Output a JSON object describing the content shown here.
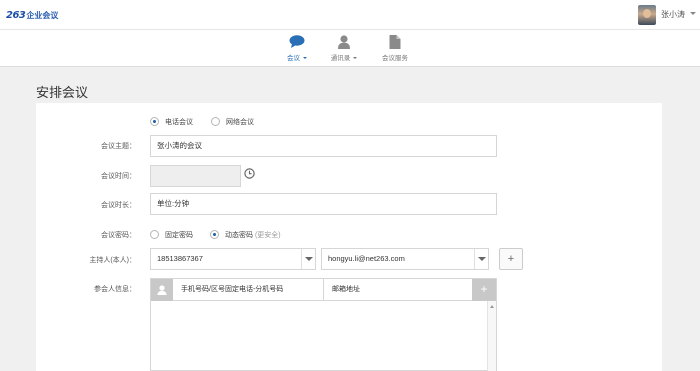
{
  "header": {
    "logo_number": "263",
    "logo_text": "企业会议",
    "username": "张小涛"
  },
  "nav": {
    "items": [
      {
        "label": "会议",
        "icon": "chat-bubble-icon",
        "active": true,
        "has_dropdown": true
      },
      {
        "label": "通讯录",
        "icon": "person-icon",
        "active": false,
        "has_dropdown": true
      },
      {
        "label": "会议服务",
        "icon": "document-icon",
        "active": false,
        "has_dropdown": false
      }
    ]
  },
  "page": {
    "title": "安排会议"
  },
  "form": {
    "meeting_type": {
      "options": [
        "电话会议",
        "网络会议"
      ],
      "selected": "电话会议"
    },
    "subject": {
      "label": "会议主题：",
      "value": "张小涛的会议"
    },
    "time": {
      "label": "会议时间：",
      "value": ""
    },
    "duration": {
      "label": "会议时长：",
      "placeholder": "单位:分钟"
    },
    "password": {
      "label": "会议密码：",
      "options": [
        "固定密码",
        "动态密码"
      ],
      "dynamic_hint": "(更安全)",
      "selected": "动态密码"
    },
    "host": {
      "label": "主持人(本人)：",
      "phone": "18513867367",
      "email": "hongyu.li@net263.com"
    },
    "participants": {
      "label": "参会人信息：",
      "col_phone": "手机号码/区号固定电话-分机号码",
      "col_email": "邮箱地址"
    }
  },
  "colors": {
    "accent": "#1e5fa8",
    "nav_active": "#2a6eb5",
    "page_bg": "#f0f0f0"
  }
}
